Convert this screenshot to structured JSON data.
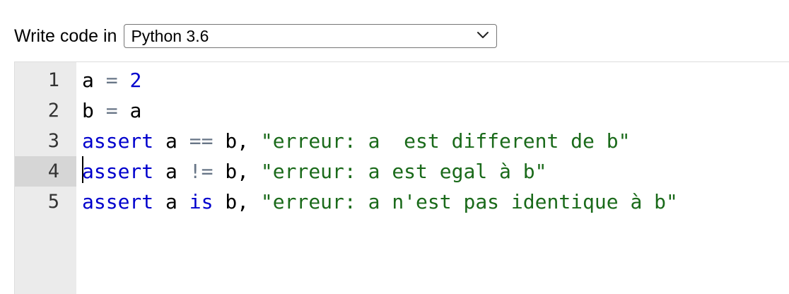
{
  "toolbar": {
    "label": "Write code in",
    "language_select": {
      "value": "Python 3.6",
      "icon": "chevron-down-icon"
    }
  },
  "editor": {
    "active_line": 4,
    "lines": [
      {
        "number": "1",
        "tokens": [
          {
            "type": "var",
            "text": "a"
          },
          {
            "type": "plain",
            "text": " "
          },
          {
            "type": "op",
            "text": "="
          },
          {
            "type": "plain",
            "text": " "
          },
          {
            "type": "num",
            "text": "2"
          }
        ]
      },
      {
        "number": "2",
        "tokens": [
          {
            "type": "var",
            "text": "b"
          },
          {
            "type": "plain",
            "text": " "
          },
          {
            "type": "op",
            "text": "="
          },
          {
            "type": "plain",
            "text": " "
          },
          {
            "type": "var",
            "text": "a"
          }
        ]
      },
      {
        "number": "3",
        "tokens": [
          {
            "type": "kw",
            "text": "assert"
          },
          {
            "type": "plain",
            "text": " "
          },
          {
            "type": "var",
            "text": "a"
          },
          {
            "type": "plain",
            "text": " "
          },
          {
            "type": "op",
            "text": "=="
          },
          {
            "type": "plain",
            "text": " "
          },
          {
            "type": "var",
            "text": "b"
          },
          {
            "type": "plain",
            "text": ", "
          },
          {
            "type": "str",
            "text": "\"erreur: a  est different de b\""
          }
        ]
      },
      {
        "number": "4",
        "tokens": [
          {
            "type": "kw",
            "text": "assert"
          },
          {
            "type": "plain",
            "text": " "
          },
          {
            "type": "var",
            "text": "a"
          },
          {
            "type": "plain",
            "text": " "
          },
          {
            "type": "op",
            "text": "!="
          },
          {
            "type": "plain",
            "text": " "
          },
          {
            "type": "var",
            "text": "b"
          },
          {
            "type": "plain",
            "text": ", "
          },
          {
            "type": "str",
            "text": "\"erreur: a est egal à b\""
          }
        ]
      },
      {
        "number": "5",
        "tokens": [
          {
            "type": "kw",
            "text": "assert"
          },
          {
            "type": "plain",
            "text": " "
          },
          {
            "type": "var",
            "text": "a"
          },
          {
            "type": "plain",
            "text": " "
          },
          {
            "type": "kw",
            "text": "is"
          },
          {
            "type": "plain",
            "text": " "
          },
          {
            "type": "var",
            "text": "b"
          },
          {
            "type": "plain",
            "text": ", "
          },
          {
            "type": "str",
            "text": "\"erreur: a n'est pas identique à b\""
          }
        ]
      }
    ]
  },
  "colors": {
    "keyword": "#0000cd",
    "number": "#0000cd",
    "operator": "#687687",
    "string": "#1a6a1a",
    "gutter_bg": "#ebebeb",
    "active_gutter_bg": "#d6d6d6"
  }
}
